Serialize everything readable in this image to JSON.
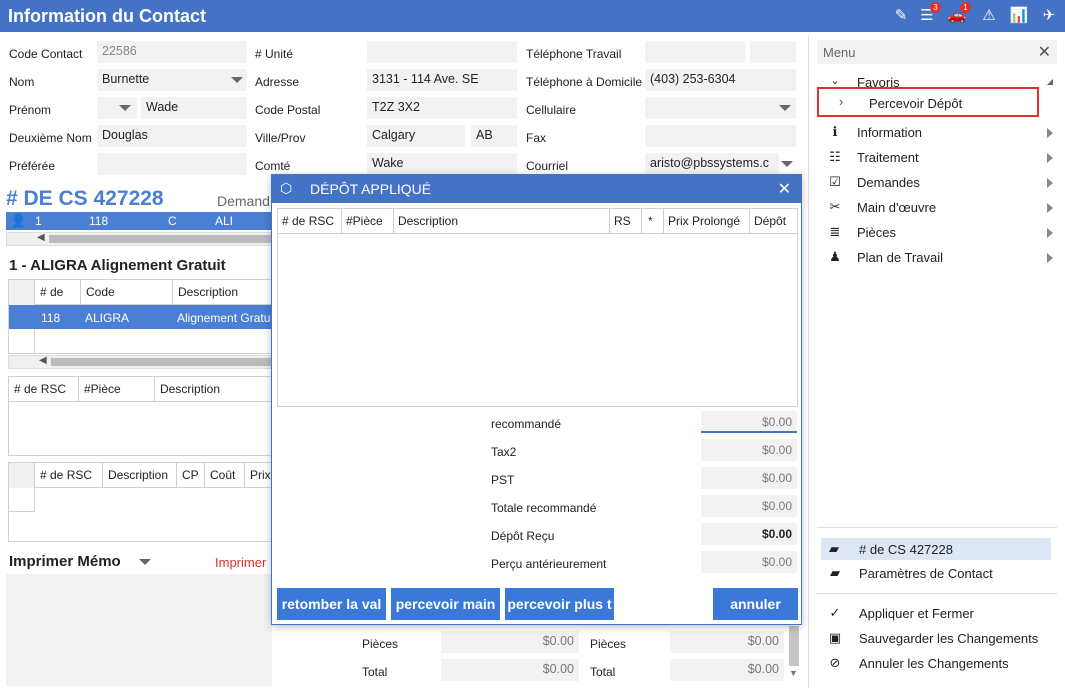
{
  "app": {
    "title": "Information du Contact"
  },
  "titlebar": {
    "icons": [
      "edit-icon",
      "list-icon",
      "car-icon",
      "warning-icon",
      "chart-icon",
      "plane-icon"
    ],
    "list_badge": "3",
    "car_badge": "1"
  },
  "contact": {
    "code_label": "Code Contact",
    "code_value": "22586",
    "nom_label": "Nom",
    "nom_value": "Burnette",
    "prenom_label": "Prénom",
    "prenom_value": "Wade",
    "deuxieme_label": "Deuxième Nom",
    "deuxieme_value": "Douglas",
    "preferee_label": "Préférée",
    "preferee_value": "",
    "unite_label": "# Unité",
    "unite_value": "",
    "adresse_label": "Adresse",
    "adresse_value": "3131 - 114 Ave. SE",
    "postal_label": "Code Postal",
    "postal_value": "T2Z 3X2",
    "ville_label": "Ville/Prov",
    "ville_value": "Calgary",
    "prov_value": "AB",
    "comte_label": "Comté",
    "comte_value": "Wake",
    "tel_travail_label": "Téléphone Travail",
    "tel_travail_value": "",
    "tel_domicile_label": "Téléphone à Domicile",
    "tel_domicile_value": "(403) 253-6304",
    "cellulaire_label": "Cellulaire",
    "cellulaire_value": "",
    "fax_label": "Fax",
    "fax_value": "",
    "courriel_label": "Courriel",
    "courriel_value": "aristo@pbssystems.c"
  },
  "cs": {
    "number": "# DE CS 427228",
    "demand_label": "Demand",
    "row": {
      "c1": "1",
      "c2": "118",
      "c3": "C",
      "c4": "ALI"
    }
  },
  "section1": {
    "title": "1 - ALIGRA Alignement Gratuit",
    "headers": [
      "# de",
      "Code",
      "Description"
    ],
    "row": [
      "118",
      "ALIGRA",
      "Alignement Gratu"
    ]
  },
  "grid2": {
    "headers": [
      "# de RSC",
      "#Pièce",
      "Description"
    ]
  },
  "grid3": {
    "headers": [
      "# de RSC",
      "Description",
      "CP",
      "Coût",
      "Prix"
    ]
  },
  "memo": {
    "title": "Imprimer Mémo",
    "link": "Imprimer"
  },
  "bottom_totals": {
    "pieces_label": "Pièces",
    "pieces_value": "$0.00",
    "total_label": "Total",
    "total_value": "$0.00",
    "pieces2_label": "Pièces",
    "pieces2_value": "$0.00",
    "total2_label": "Total",
    "total2_value": "$0.00"
  },
  "modal": {
    "title": "DÉPÔT APPLIQUÉ",
    "headers": [
      "# de RSC",
      "#Pièce",
      "Description",
      "RS",
      "*",
      "Prix Prolongé",
      "Dépôt"
    ],
    "totals": [
      {
        "label": "recommandé",
        "value": "$0.00"
      },
      {
        "label": "Tax2",
        "value": "$0.00"
      },
      {
        "label": "PST",
        "value": "$0.00"
      },
      {
        "label": "Totale recommandé",
        "value": "$0.00"
      },
      {
        "label": "Dépôt Reçu",
        "value": "$0.00"
      },
      {
        "label": "Perçu antérieurement",
        "value": "$0.00"
      }
    ],
    "buttons": {
      "retomber": "retomber la val",
      "percevoir_main": "percevoir main",
      "percevoir_plus": "percevoir plus t",
      "annuler": "annuler"
    }
  },
  "sidebar": {
    "menu_label": "Menu",
    "favoris": "Favoris",
    "percevoir": "Percevoir Dépôt",
    "items": [
      {
        "label": "Information",
        "icon": "info-icon"
      },
      {
        "label": "Traitement",
        "icon": "list-icon"
      },
      {
        "label": "Demandes",
        "icon": "clipboard-icon"
      },
      {
        "label": "Main d'œuvre",
        "icon": "tools-icon"
      },
      {
        "label": "Pièces",
        "icon": "layers-icon"
      },
      {
        "label": "Plan de Travail",
        "icon": "worker-icon"
      }
    ],
    "cs_item": "# de CS 427228",
    "params_item": "Paramètres de Contact",
    "apply_item": "Appliquer et Fermer",
    "save_item": "Sauvegarder les Changements",
    "cancel_item": "Annuler les Changements"
  }
}
